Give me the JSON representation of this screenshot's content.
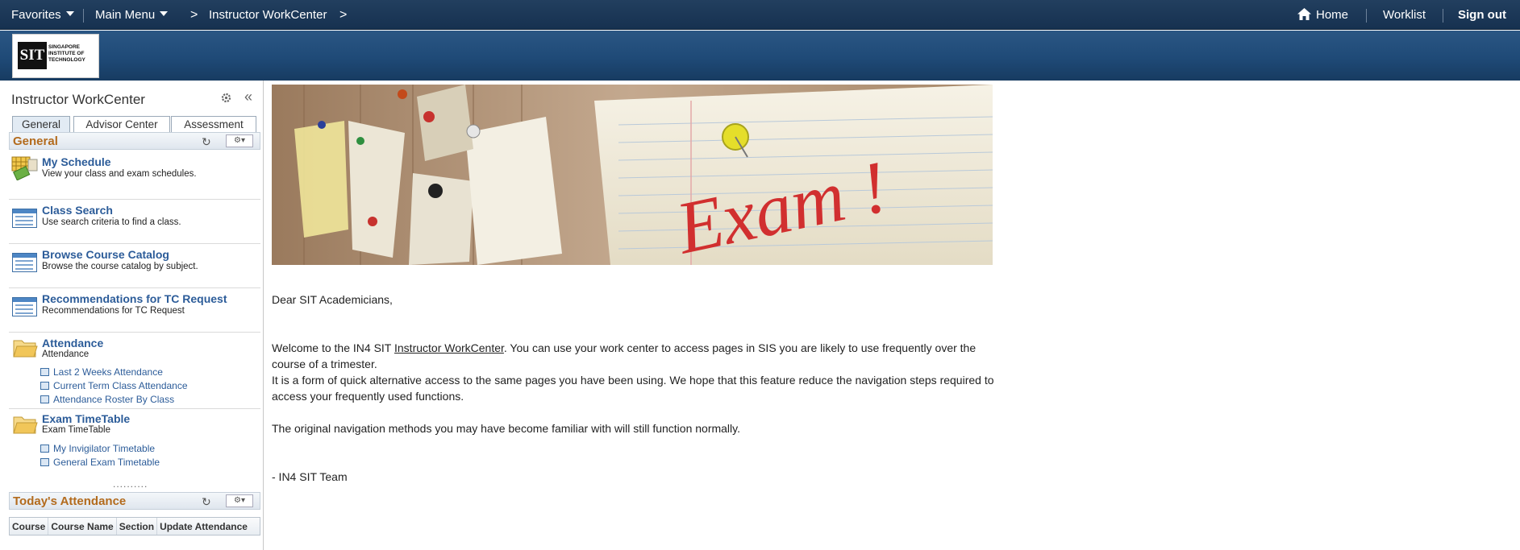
{
  "topbar": {
    "favorites": "Favorites",
    "main_menu": "Main Menu",
    "breadcrumb": "Instructor WorkCenter",
    "home": "Home",
    "worklist": "Worklist",
    "signout": "Sign out"
  },
  "logo": {
    "abbr": "SIT",
    "text": "SINGAPORE INSTITUTE OF TECHNOLOGY"
  },
  "sidebar": {
    "title": "Instructor WorkCenter",
    "collapse": "«",
    "tabs": [
      "General",
      "Advisor Center",
      "Assessment"
    ],
    "general_section": "General",
    "items": [
      {
        "title": "My Schedule",
        "desc": "View your class and exam schedules."
      },
      {
        "title": "Class Search",
        "desc": "Use search criteria to find a class."
      },
      {
        "title": "Browse Course Catalog",
        "desc": "Browse the course catalog by subject."
      },
      {
        "title": "Recommendations for TC Request",
        "desc": "Recommendations for TC Request"
      },
      {
        "title": "Attendance",
        "desc": "Attendance",
        "links": [
          "Last 2 Weeks Attendance",
          "Current Term Class Attendance",
          "Attendance Roster By Class"
        ]
      },
      {
        "title": "Exam TimeTable",
        "desc": "Exam TimeTable",
        "links": [
          "My Invigilator Timetable",
          "General Exam Timetable"
        ]
      }
    ],
    "splitter": "..........",
    "attendance_section": "Today's Attendance",
    "attendance_columns": [
      "Course",
      "Course Name",
      "Section",
      "Update Attendance"
    ]
  },
  "hero": {
    "text": "Exam !"
  },
  "message": {
    "greeting": "Dear SIT Academicians,",
    "p1_pre": "Welcome to the IN4 SIT ",
    "p1_link": "Instructor WorkCenter",
    "p1_post": ". You can use your work center to access pages in SIS you are likely to use frequently over the course of a trimester.",
    "p2": "It is a form of quick alternative access to the same pages you have been using. We hope that this feature reduce the navigation steps required to access your frequently used functions.",
    "p3": "The original navigation methods you may have become familiar with will still function normally.",
    "signoff": "- IN4 SIT Team"
  }
}
